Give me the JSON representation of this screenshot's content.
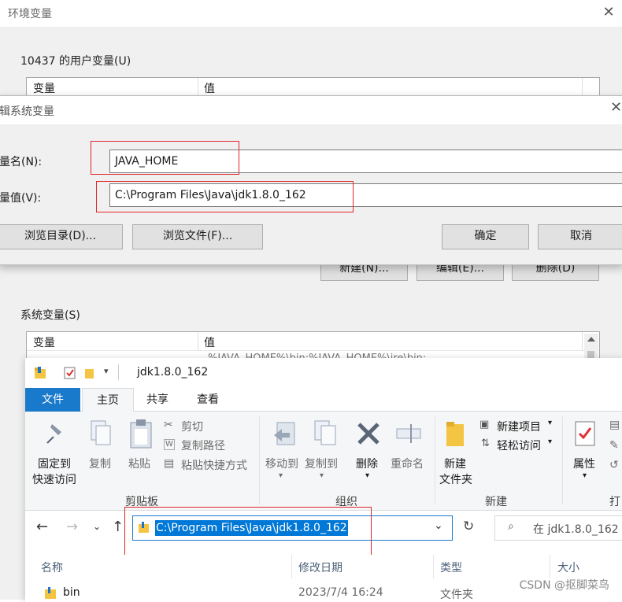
{
  "env": {
    "title": "环境变量",
    "close": "✕",
    "user_group": "10437 的用户变量(U)",
    "user_headers": [
      "变量",
      "值"
    ],
    "user_buttons": [
      "新建(N)...",
      "编辑(E)...",
      "删除(D)"
    ],
    "system_group": "系统变量(S)",
    "system_headers": [
      "变量",
      "值"
    ],
    "system_row_partial": "%JAVA_HOME%\\bin;%JAVA_HOME%\\jre\\bin;"
  },
  "edit_dialog": {
    "title": "辑系统变量",
    "close": "✕",
    "name_label": "量名(N):",
    "name_value": "JAVA_HOME",
    "value_label": "量值(V):",
    "value_value": "C:\\Program Files\\Java\\jdk1.8.0_162",
    "browse_dir": "浏览目录(D)...",
    "browse_file": "浏览文件(F)...",
    "ok": "确定",
    "cancel": "取消"
  },
  "explorer": {
    "title": "jdk1.8.0_162",
    "tabs": [
      "文件",
      "主页",
      "共享",
      "查看"
    ],
    "clipboard": {
      "pin": "固定到",
      "pin2": "快速访问",
      "copy": "复制",
      "paste": "粘贴",
      "cut": "剪切",
      "copy_path": "复制路径",
      "paste_shortcut": "粘贴快捷方式",
      "group": "剪贴板"
    },
    "organize": {
      "move_to": "移动到",
      "copy_to": "复制到",
      "delete": "删除",
      "rename": "重命名",
      "group": "组织"
    },
    "new": {
      "new_folder": "新建",
      "new_folder2": "文件夹",
      "new_item": "新建项目",
      "easy_access": "轻松访问",
      "group": "新建"
    },
    "open": {
      "properties": "属性",
      "group": "打"
    },
    "address": "C:\\Program Files\\Java\\jdk1.8.0_162",
    "search_placeholder": "在 jdk1.8.0_162",
    "columns": [
      "名称",
      "修改日期",
      "类型",
      "大小"
    ],
    "rows": [
      {
        "name": "bin",
        "date": "2023/7/4 16:24",
        "type": "文件夹"
      }
    ]
  },
  "watermark": "CSDN @抠脚菜鸟",
  "colors": {
    "accent": "#1979ca",
    "highlight": "#e0262b",
    "selection": "#0078d7"
  }
}
